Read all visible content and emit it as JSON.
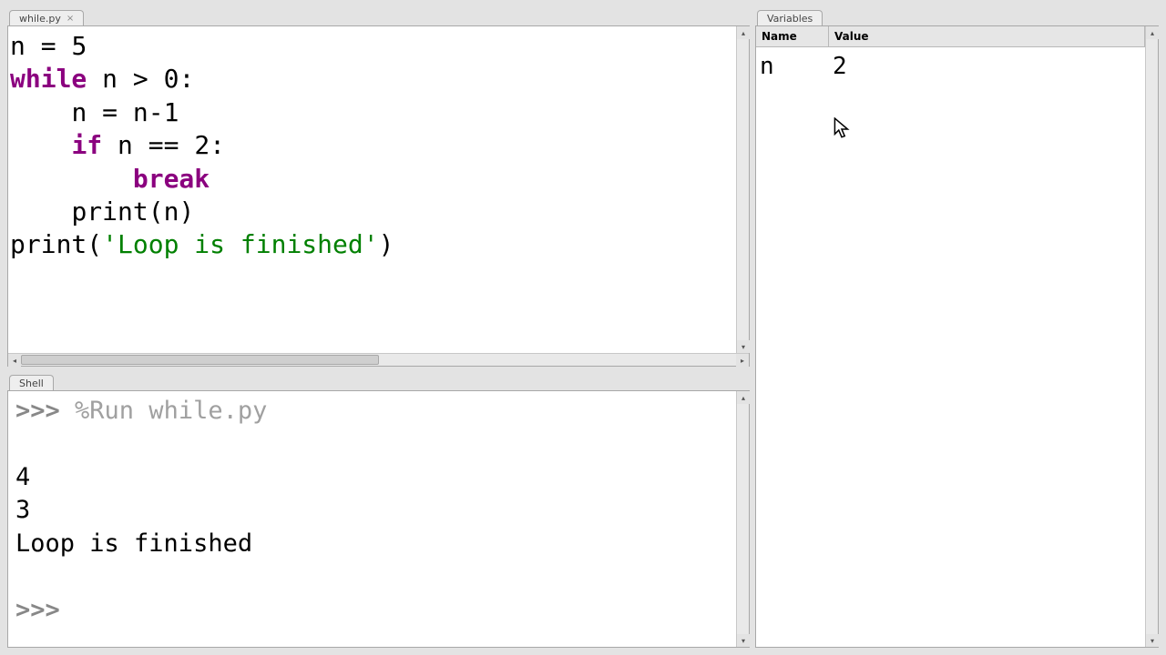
{
  "editor": {
    "tab_label": "while.py",
    "code": {
      "l1": {
        "a": "n = ",
        "num": "5"
      },
      "l2": {
        "kw": "while",
        "rest": " n > ",
        "num": "0",
        "colon": ":"
      },
      "l3": {
        "indent": "    ",
        "text": "n = n-",
        "num": "1"
      },
      "l4": {
        "indent": "    ",
        "kw": "if",
        "rest": " n == ",
        "num": "2",
        "colon": ":"
      },
      "l5": {
        "indent": "        ",
        "kw": "break"
      },
      "l6": {
        "indent": "    ",
        "text": "print(n)"
      },
      "l7": {
        "a": "print(",
        "str": "'Loop is finished'",
        "b": ")"
      }
    }
  },
  "shell": {
    "tab_label": "Shell",
    "prompt": ">>> ",
    "run_cmd": "%Run while.py",
    "out1": "4",
    "out2": "3",
    "out3": "Loop is finished",
    "prompt2": ">>> "
  },
  "variables": {
    "tab_label": "Variables",
    "col_name": "Name",
    "col_value": "Value",
    "rows": [
      {
        "name": "n",
        "value": "2"
      }
    ]
  }
}
